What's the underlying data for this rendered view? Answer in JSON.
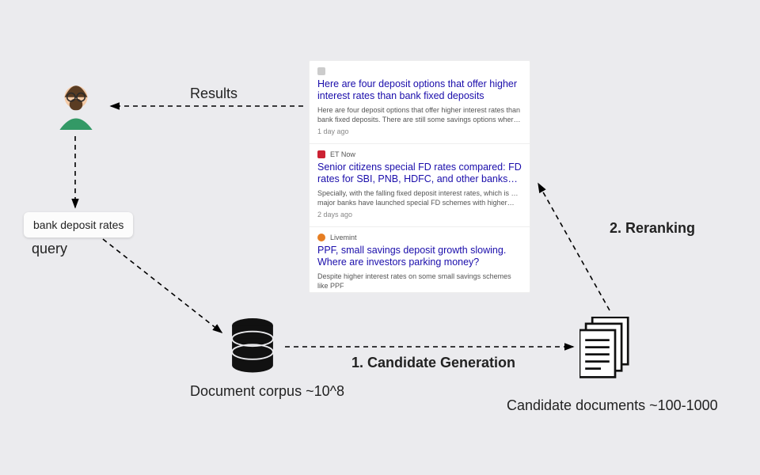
{
  "query": {
    "text": "bank deposit rates"
  },
  "labels": {
    "results": "Results",
    "query": "query",
    "corpus": "Document corpus ~10^8",
    "candidates": "Candidate documents ~100-1000",
    "step1": "1. Candidate Generation",
    "step2": "2. Reranking"
  },
  "results": [
    {
      "source": "",
      "fav": "",
      "title": "Here are four deposit options that offer higher interest rates than bank fixed deposits",
      "snippet": "Here are four deposit options that offer higher interest rates than bank fixed deposits. There are still some savings options where you can earn …",
      "age": "1 day ago"
    },
    {
      "source": "ET Now",
      "fav": "red",
      "title": "Senior citizens special FD rates compared: FD rates for SBI, PNB, HDFC, and other banks compared",
      "snippet": "Specially, with the falling fixed deposit interest rates, which is … major banks have launched special FD schemes with higher interest rates as …",
      "age": "2 days ago"
    },
    {
      "source": "Livemint",
      "fav": "orange",
      "title": "PPF, small savings deposit growth slowing. Where are investors parking money?",
      "snippet": "Despite higher interest rates on some small savings schemes like PPF",
      "age": ""
    }
  ]
}
